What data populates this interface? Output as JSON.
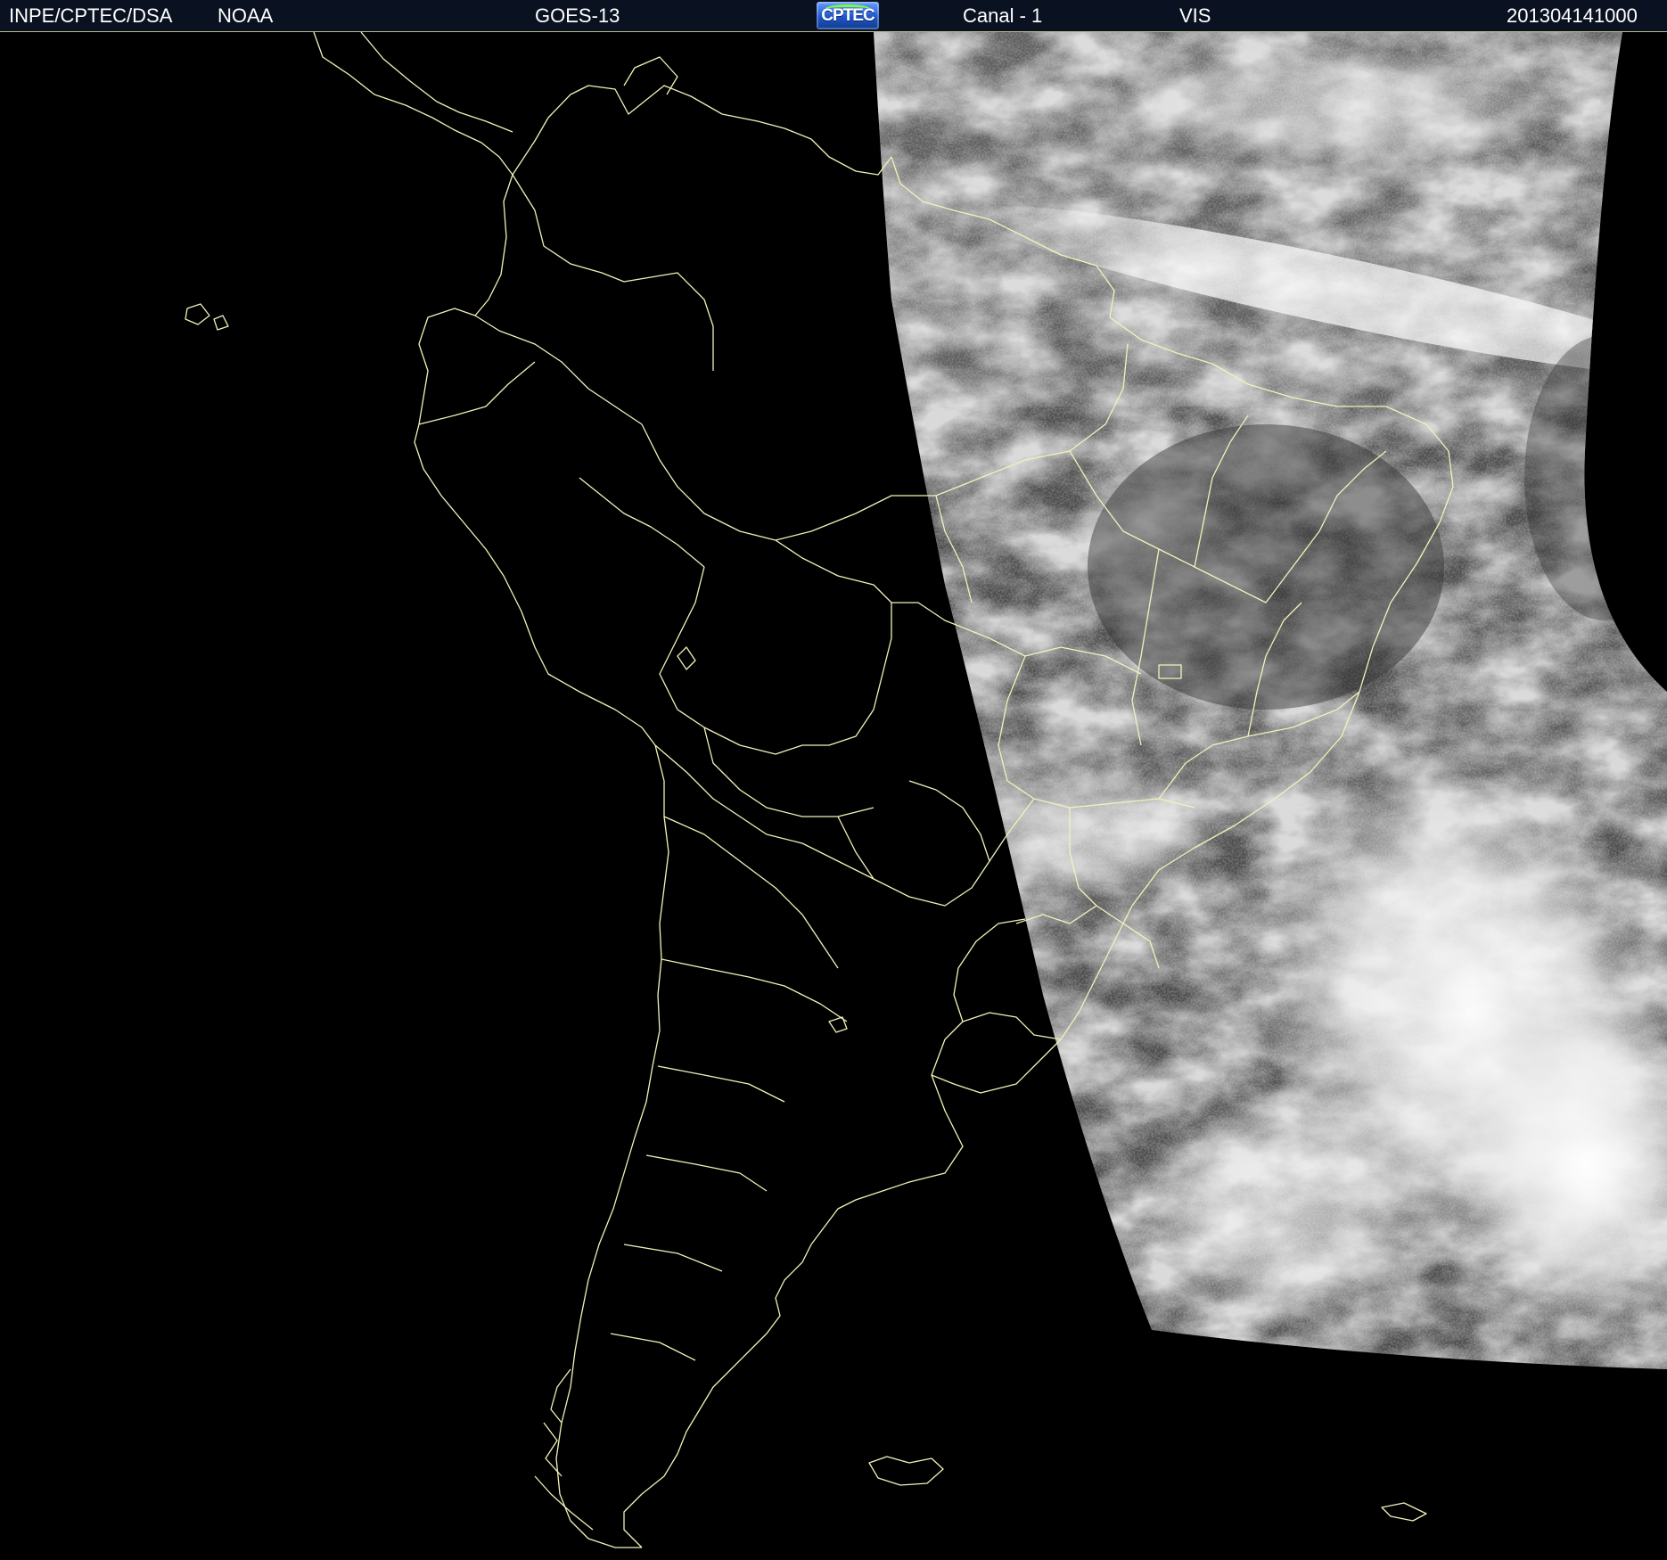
{
  "header": {
    "organization": "INPE/CPTEC/DSA",
    "agency": "NOAA",
    "satellite": "GOES-13",
    "logo_text": "CPTEC",
    "channel": "Canal - 1",
    "band": "VIS",
    "timestamp": "201304141000"
  },
  "colors": {
    "header_background": "#0a1222",
    "header_text": "#ffffff",
    "border_lines": "#f3f2b9",
    "background": "#000000",
    "cloud_bright": "#f2f2f2",
    "cloud_mid": "#8a8a8a",
    "surface_dark": "#3a3a3a"
  },
  "icons": {
    "logo": "cptec-logo"
  }
}
